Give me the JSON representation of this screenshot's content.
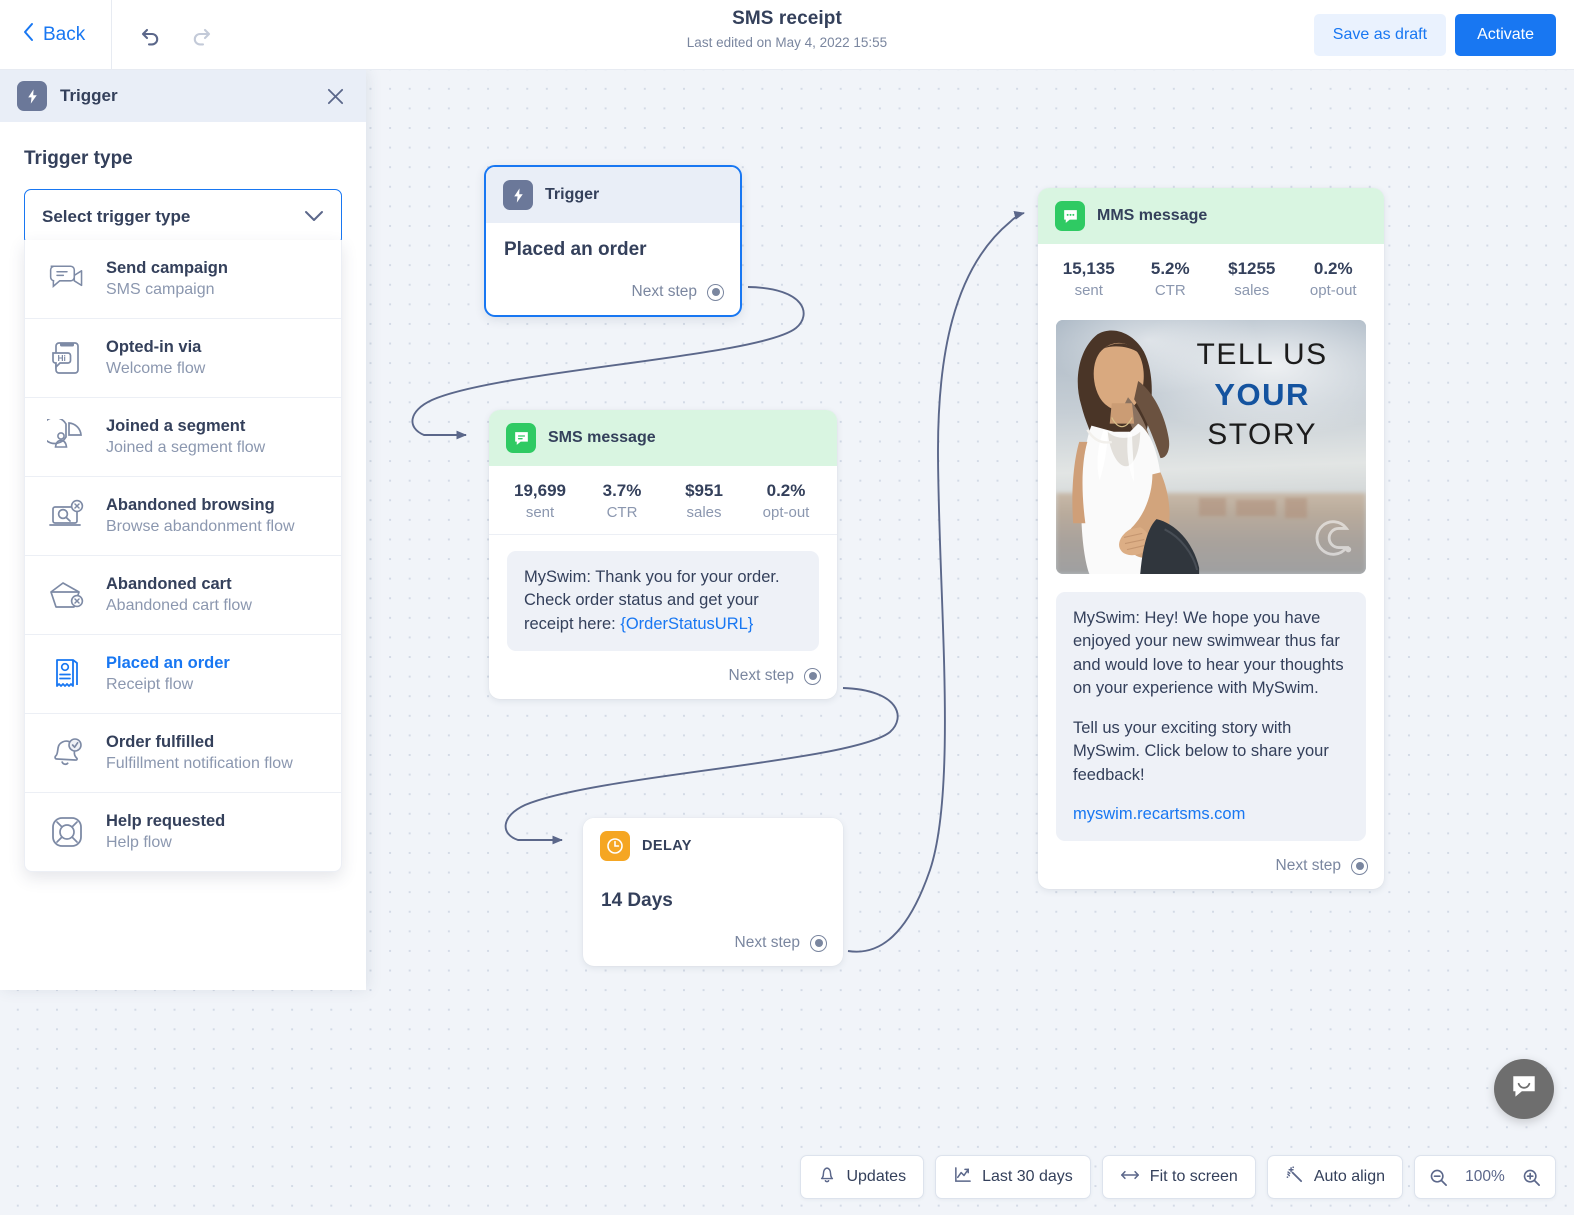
{
  "header": {
    "back_label": "Back",
    "undo_icon": "undo-icon",
    "redo_icon": "redo-icon",
    "title": "SMS receipt",
    "subtitle": "Last edited on May 4, 2022 15:55",
    "save_draft_label": "Save as draft",
    "activate_label": "Activate"
  },
  "panel": {
    "title": "Trigger",
    "close_icon": "close-icon",
    "section_label": "Trigger type",
    "select_value": "Select trigger type",
    "select_chevron": "chevron-down-icon",
    "options": [
      {
        "name": "Send campaign",
        "sub": "SMS campaign",
        "icon": "megaphone-chat-icon",
        "selected": false
      },
      {
        "name": "Opted-in via",
        "sub": "Welcome flow",
        "icon": "phone-hi-icon",
        "selected": false
      },
      {
        "name": "Joined a segment",
        "sub": "Joined a segment flow",
        "icon": "pie-user-icon",
        "selected": false
      },
      {
        "name": "Abandoned browsing",
        "sub": "Browse abandonment flow",
        "icon": "laptop-search-x-icon",
        "selected": false
      },
      {
        "name": "Abandoned cart",
        "sub": "Abandoned cart flow",
        "icon": "cart-x-icon",
        "selected": false
      },
      {
        "name": "Placed an order",
        "sub": "Receipt flow",
        "icon": "receipt-icon",
        "selected": true
      },
      {
        "name": "Order fulfilled",
        "sub": "Fulfillment notification flow",
        "icon": "bell-check-icon",
        "selected": false
      },
      {
        "name": "Help requested",
        "sub": "Help flow",
        "icon": "lifebuoy-icon",
        "selected": false
      }
    ]
  },
  "flow": {
    "trigger": {
      "header_label": "Trigger",
      "header_icon": "bolt-icon",
      "title": "Placed an order",
      "next_step_label": "Next step",
      "port_icon": "connector-port-icon"
    },
    "sms": {
      "header_label": "SMS message",
      "header_icon": "sms-chat-icon",
      "stats": [
        {
          "value": "19,699",
          "label": "sent"
        },
        {
          "value": "3.7%",
          "label": "CTR"
        },
        {
          "value": "$951",
          "label": "sales"
        },
        {
          "value": "0.2%",
          "label": "opt-out"
        }
      ],
      "message_text": "MySwim: Thank you for your order. Check order status and get your receipt here: ",
      "message_link": "{OrderStatusURL}",
      "next_step_label": "Next step",
      "port_icon": "connector-port-icon"
    },
    "delay": {
      "header_label": "DELAY",
      "header_icon": "clock-icon",
      "title": "14 Days",
      "next_step_label": "Next step",
      "port_icon": "connector-port-icon"
    },
    "mms": {
      "header_label": "MMS message",
      "header_icon": "mms-chat-icon",
      "stats": [
        {
          "value": "15,135",
          "label": "sent"
        },
        {
          "value": "5.2%",
          "label": "CTR"
        },
        {
          "value": "$1255",
          "label": "sales"
        },
        {
          "value": "0.2%",
          "label": "opt-out"
        }
      ],
      "creative": {
        "line1": "TELL US",
        "line2": "YOUR",
        "line3": "STORY",
        "alt": "woman in white swimsuit holding surfboard on beach",
        "watermark_icon": "recart-logo-icon"
      },
      "message_p1": "MySwim: Hey! We hope you have enjoyed your new swimwear thus far and would love to hear your thoughts on your experience with MySwim.",
      "message_p2": "Tell us your exciting story with MySwim. Click below to share your feedback!",
      "message_link": "myswim.recartsms.com",
      "next_step_label": "Next step",
      "port_icon": "connector-port-icon"
    }
  },
  "toolbar": {
    "updates_label": "Updates",
    "updates_icon": "bell-icon",
    "date_range_label": "Last 30 days",
    "date_range_icon": "analytics-icon",
    "fit_label": "Fit to screen",
    "fit_icon": "arrows-horizontal-icon",
    "align_label": "Auto align",
    "align_icon": "magic-wand-icon",
    "zoom_out_icon": "zoom-out-icon",
    "zoom_value": "100%",
    "zoom_in_icon": "zoom-in-icon"
  },
  "chat_widget": {
    "icon": "chat-smile-icon"
  },
  "colors": {
    "accent_blue": "#1877f2",
    "text_slate": "#34405b",
    "muted": "#8b97af",
    "green_header": "#d9f5e1",
    "green_badge": "#2fca63",
    "amber_badge": "#f5a623",
    "slate_badge": "#6b7899",
    "canvas_bg": "#f1f4f9",
    "connector": "#5b678a"
  }
}
